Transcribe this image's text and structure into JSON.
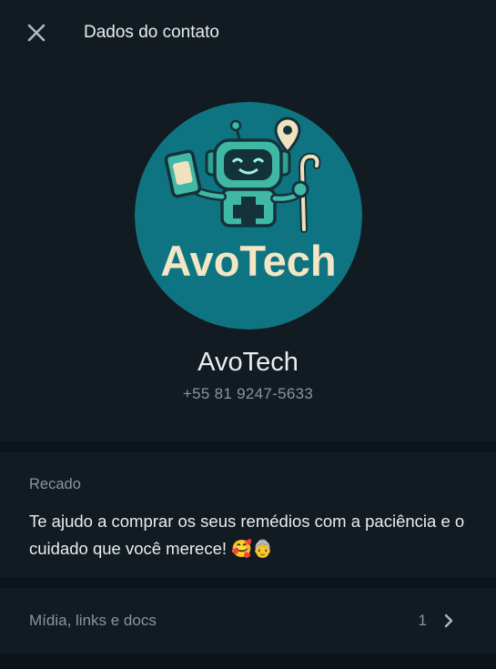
{
  "header": {
    "title": "Dados do contato",
    "close_icon": "close-icon"
  },
  "profile": {
    "avatar_text": "AvoTech",
    "name": "AvoTech",
    "phone": "+55 81 9247-5633",
    "avatar_bg": "#0f7482"
  },
  "about": {
    "label": "Recado",
    "text": "Te ajudo a comprar os seus remédios com a paciência e o cuidado que você merece!",
    "emojis": "🥰👵"
  },
  "media": {
    "label": "Mídia, links e docs",
    "count": "1",
    "chevron_icon": "chevron-right-icon"
  },
  "colors": {
    "panel": "#111b21",
    "background": "#0b141a",
    "primary_text": "#e9edef",
    "secondary_text": "#8696a0"
  }
}
